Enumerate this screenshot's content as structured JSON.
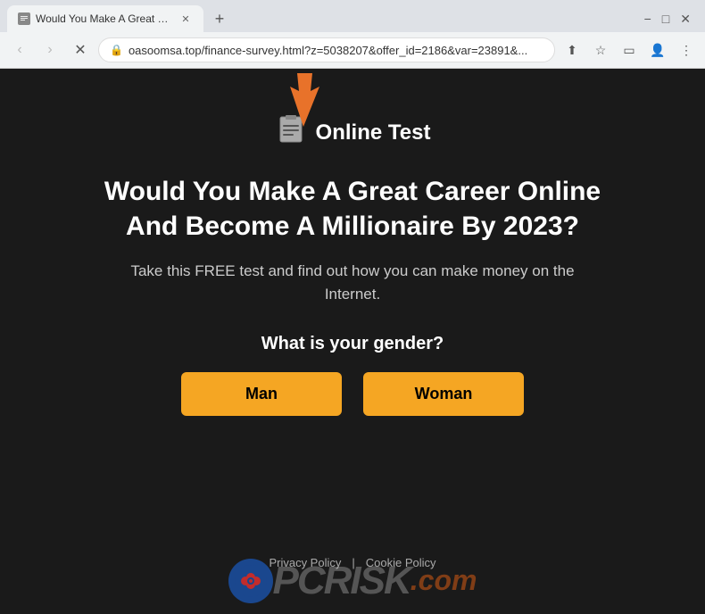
{
  "browser": {
    "tab_title": "Would You Make A Great Caree",
    "url": "oasoomsa.top/finance-survey.html?z=5038207&offer_id=2186&var=23891&...",
    "new_tab_icon": "+",
    "nav": {
      "back_label": "‹",
      "forward_label": "›",
      "reload_label": "✕"
    },
    "window_controls": {
      "minimize": "−",
      "maximize": "□",
      "close": "✕"
    }
  },
  "page": {
    "logo_icon": "📋",
    "logo_label": "Online Test",
    "main_heading": "Would You Make A Great Career Online And Become A Millionaire By 2023?",
    "sub_heading": "Take this FREE test and find out how you can make money on the Internet.",
    "question": "What is your gender?",
    "btn_man": "Man",
    "btn_woman": "Woman",
    "footer_privacy": "Privacy Policy",
    "footer_cookie": "Cookie Policy",
    "footer_divider": "|",
    "watermark_text": "PC",
    "watermark_risk": "RISK",
    "watermark_com": ".com"
  },
  "colors": {
    "bg": "#1a1a1a",
    "btn_orange": "#f5a623",
    "arrow_orange": "#e8722a",
    "text_white": "#ffffff",
    "text_gray": "#cccccc"
  }
}
